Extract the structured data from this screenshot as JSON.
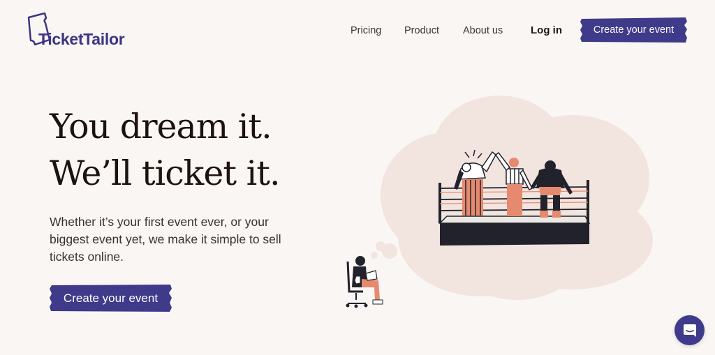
{
  "brand": {
    "name": "TicketTailor",
    "accent_color": "#3f3a8a"
  },
  "nav": {
    "items": [
      {
        "label": "Pricing"
      },
      {
        "label": "Product"
      },
      {
        "label": "About us"
      }
    ],
    "login_label": "Log in",
    "cta_label": "Create your event"
  },
  "hero": {
    "headline_line1": "You dream it.",
    "headline_line2": "We’ll ticket it.",
    "subtext": "Whether it’s your first event ever, or your biggest event yet, we make it simple to sell tickets online.",
    "cta_label": "Create your event"
  },
  "illustration": {
    "description_icon": "wrestling-ring-dream-illustration"
  },
  "chat": {
    "icon": "chat-icon"
  }
}
